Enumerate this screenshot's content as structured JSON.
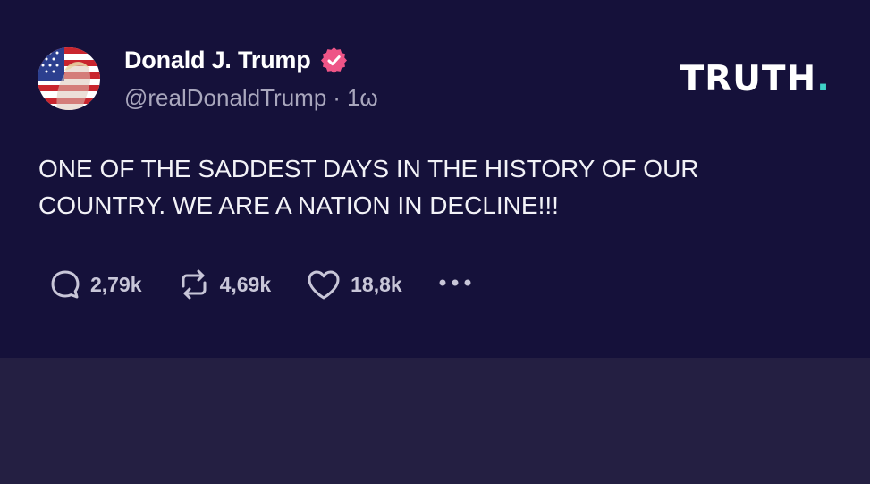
{
  "post": {
    "author": {
      "display_name": "Donald J. Trump",
      "handle": "@realDonaldTrump",
      "separator": "·",
      "timestamp": "1ω",
      "verified": true
    },
    "brand": {
      "name": "TRUTH",
      "dot": "."
    },
    "text": "ONE OF THE SADDEST DAYS IN THE HISTORY OF OUR COUNTRY. WE ARE A NATION IN DECLINE!!!",
    "actions": {
      "replies": "2,79k",
      "retruths": "4,69k",
      "likes": "18,8k",
      "more_icon": "more-horizontal-icon"
    }
  },
  "colors": {
    "card_background": "#15113a",
    "page_background": "#241f42",
    "verified_badge": "#ee5587",
    "brand_accent": "#3fd1c7",
    "muted_text": "#a9a7bd"
  }
}
